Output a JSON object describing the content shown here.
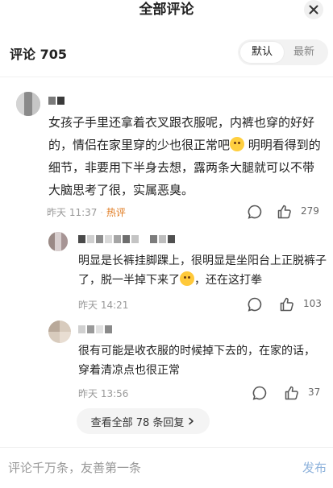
{
  "header": {
    "title": "全部评论",
    "close_icon": "close-icon"
  },
  "comments_header": {
    "count_label": "评论 705",
    "sort": {
      "default": "默认",
      "latest": "最新",
      "selected": "默认"
    }
  },
  "main_comment": {
    "text": "女孩子手里还拿着衣叉跟衣服呢，内裤也穿的好好的，情侣在家里穿的少也很正常吧",
    "emoji": "flushed-emoji",
    "text_after": " 明明看得到的细节，非要用下半身去想，露两条大腿就可以不带大脑思考了很，实属恶臭。",
    "time": "昨天 11:37",
    "tag": "热评",
    "likes": "279",
    "colors": {
      "tag": "#e07a1f"
    }
  },
  "replies": [
    {
      "text": "明显是长裤挂脚踝上，很明显是坐阳台上正脱裤子了，脱一半掉下来了",
      "emoji": "crying-laughing-emoji",
      "text_after": "，还在这打拳",
      "time": "昨天 14:21",
      "likes": "103"
    },
    {
      "text": "很有可能是收衣服的时候掉下去的，在家的话，穿着清凉点也很正常",
      "time": "昨天 13:56",
      "likes": "37"
    }
  ],
  "view_all": {
    "label": "查看全部 78 条回复",
    "chevron": "chevron-right-icon"
  },
  "bottom_bar": {
    "placeholder": "评论千万条，友善第一条",
    "publish_label": "发布",
    "colors": {
      "publish": "#8fb3dc"
    }
  }
}
